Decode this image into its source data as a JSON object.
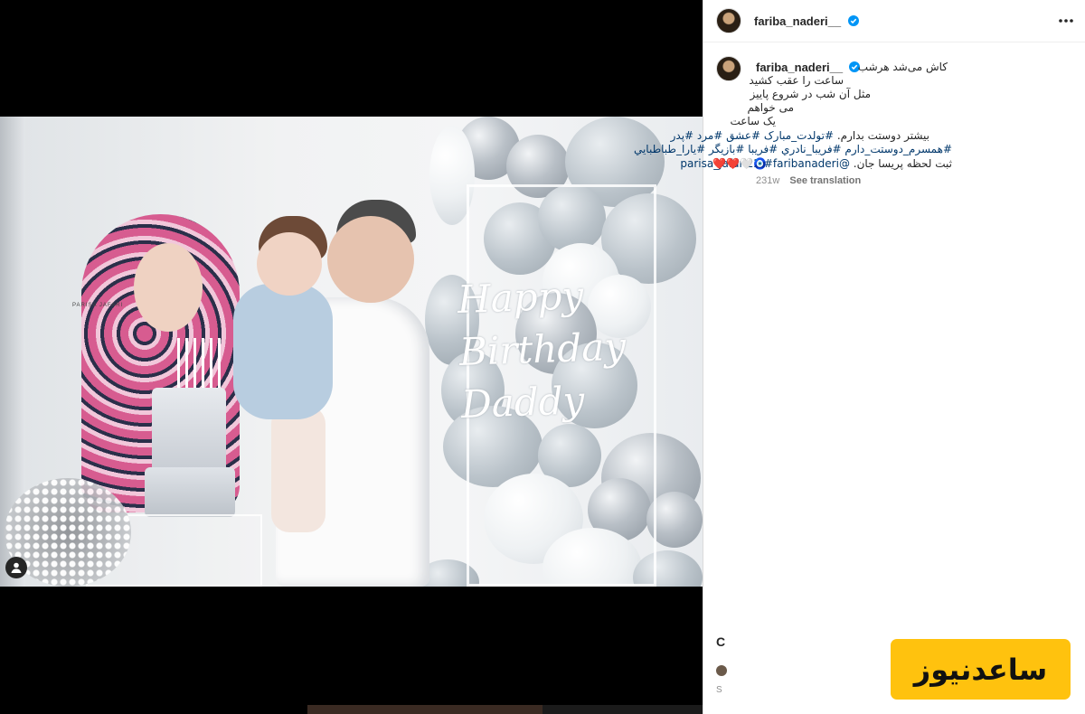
{
  "post": {
    "username": "fariba_naderi__",
    "photographer_mark": "PARISA JAFARI",
    "photo_text": [
      "Happy",
      "Birthday",
      "Daddy"
    ]
  },
  "caption": {
    "username": "fariba_naderi__",
    "lines": [
      "کاش می‌شد هرشب",
      "ساعت را عقب کشید",
      "مثل آن شب در شروع پاییز",
      "می خواهم",
      "یک ساعت",
      "بیشتر دوستت بدارم.",
      "#تولدت_مبارک #عشق #مرد #پدر",
      "#همسرم_دوستت_دارم #فريبا_نادري #فريبا #بازيگر #يارا_طباطبايي",
      "ثبت لحظه پریسا جان.",
      "@parisa_jafari22 #faribanaderi"
    ],
    "emoji": "🧿🤍❤️❤️",
    "age": "231w",
    "see_translation": "See translation"
  },
  "footer": {
    "action_hint": "C",
    "small_letter": "S"
  },
  "watermark": {
    "text": "ساعدنیوز"
  },
  "colors": {
    "accent_link": "#00376b",
    "verified_blue": "#0095f6",
    "badge_yellow": "#ffc20e"
  },
  "icons": {
    "more": "more-options-icon",
    "verified": "verified-badge-icon",
    "user_tag": "user-tag-icon"
  }
}
